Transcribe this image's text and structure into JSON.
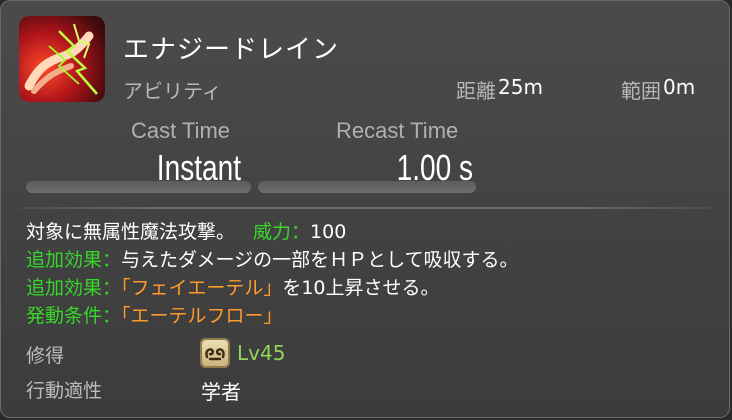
{
  "action": {
    "name": "エナジードレイン",
    "category": "アビリティ",
    "range_label": "距離",
    "range_value": "25m",
    "radius_label": "範囲",
    "radius_value": "0m",
    "icon": "energy-drain-icon"
  },
  "timing": {
    "cast_header": "Cast Time",
    "cast_value": "Instant",
    "recast_header": "Recast Time",
    "recast_value": "1.00 s"
  },
  "description": {
    "line1_text": "対象に無属性魔法攻撃。",
    "line1_potency_label": "威力：",
    "line1_potency_value": "100",
    "line2_label": "追加効果：",
    "line2_text": "与えたダメージの一部をＨＰとして吸収する。",
    "line3_label": "追加効果：",
    "line3_highlight": "「フェイエーテル」",
    "line3_text": "を10上昇させる。",
    "line4_label": "発動条件：",
    "line4_highlight": "「エーテルフロー」"
  },
  "requirements": {
    "acquired_label": "修得",
    "level": "Lv45",
    "job_icon": "scholar-job-icon",
    "class_label": "行動適性",
    "class_value": "学者"
  },
  "colors": {
    "green": "#38d629",
    "orange": "#ff9a2b",
    "level_green": "#8fd65a"
  }
}
